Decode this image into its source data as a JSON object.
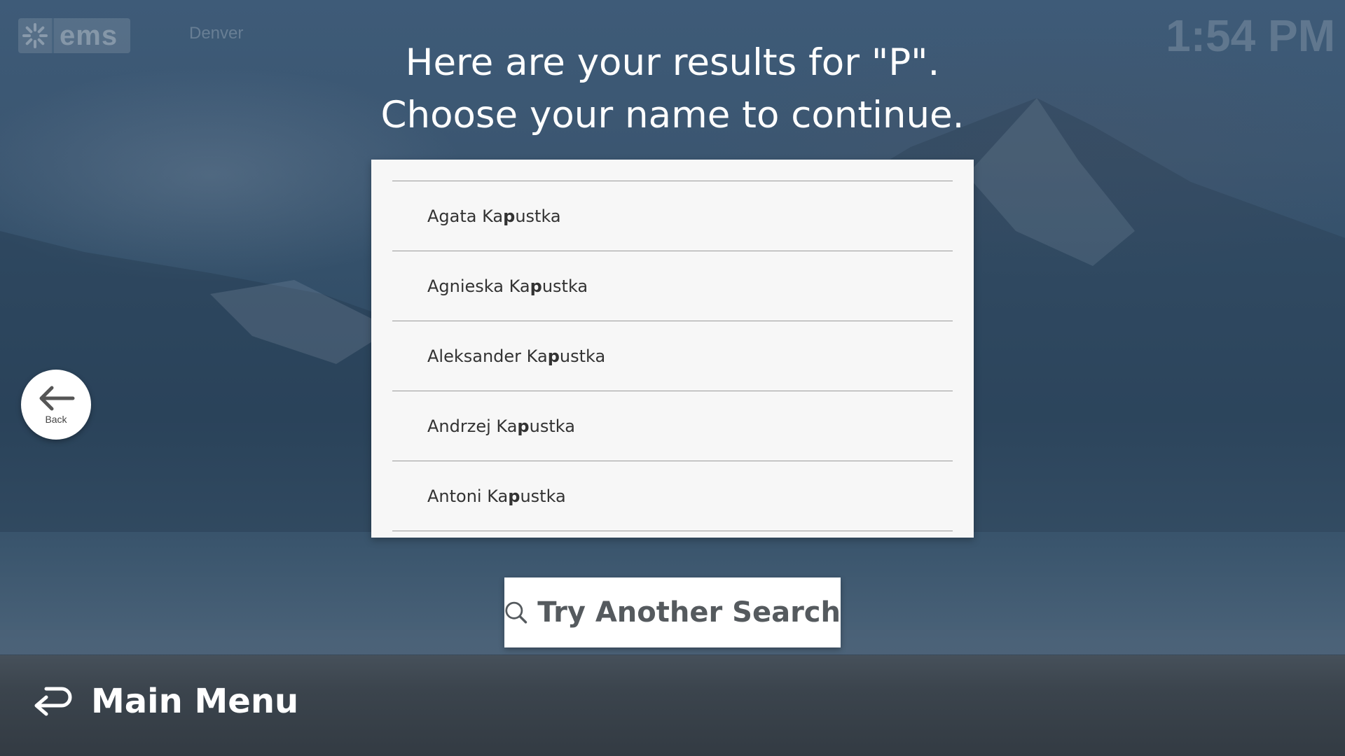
{
  "header": {
    "logo_text": "ems",
    "location": "Denver",
    "clock": "1:54 PM"
  },
  "prompt": {
    "line1": "Here are your results for \"P\".",
    "line2": "Choose your name to continue."
  },
  "results": [
    {
      "pre": "Agata Ka",
      "match": "p",
      "post": "ustka"
    },
    {
      "pre": "Agnieska Ka",
      "match": "p",
      "post": "ustka"
    },
    {
      "pre": "Aleksander Ka",
      "match": "p",
      "post": "ustka"
    },
    {
      "pre": "Andrzej Ka",
      "match": "p",
      "post": "ustka"
    },
    {
      "pre": "Antoni Ka",
      "match": "p",
      "post": "ustka"
    }
  ],
  "back_button": {
    "label": "Back",
    "icon": "arrow-left-icon"
  },
  "search_button": {
    "label": "Try Another Search",
    "icon": "search-icon"
  },
  "footer": {
    "main_menu_label": "Main Menu",
    "icon": "return-arrow-icon"
  },
  "colors": {
    "background": "#3d5872",
    "card": "#f7f7f7",
    "footer": "#3b444d"
  }
}
